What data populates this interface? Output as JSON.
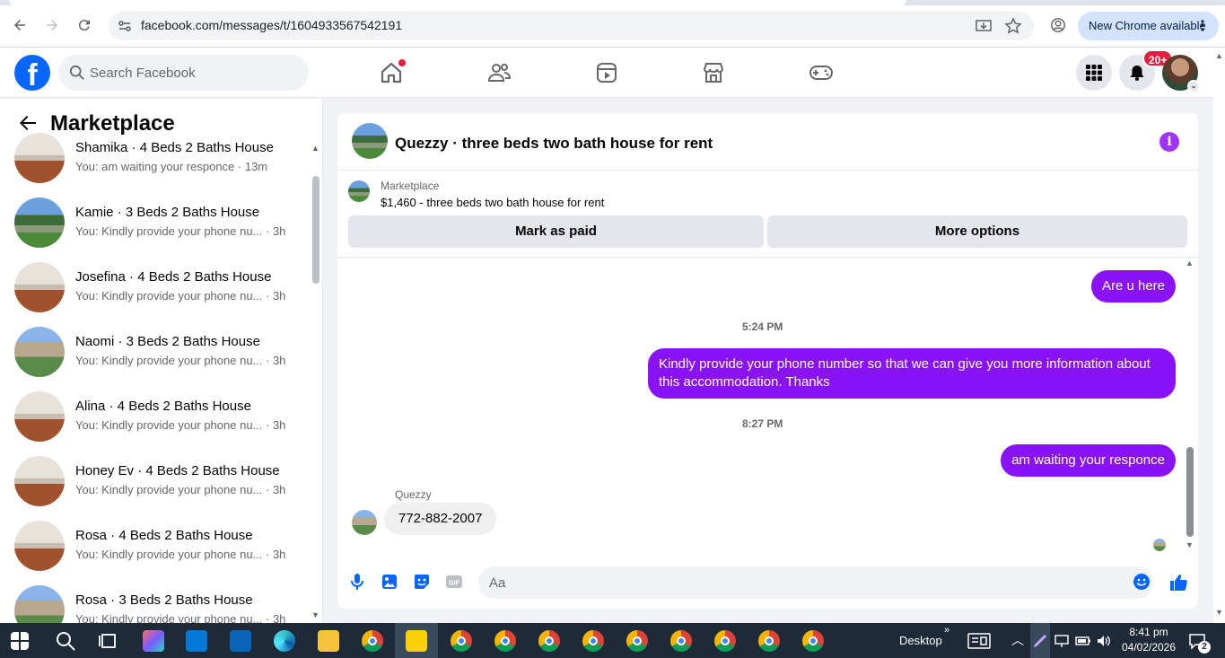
{
  "browser": {
    "url": "facebook.com/messages/t/1604933567542191",
    "new_chrome_label": "New Chrome available"
  },
  "header": {
    "search_placeholder": "Search Facebook",
    "notifications_badge": "20+"
  },
  "sidebar": {
    "title": "Marketplace",
    "conversations": [
      {
        "name": "Shamika · 4 Beds 2 Baths House",
        "preview": "You: am waiting your responce · 13m",
        "avatar": "room"
      },
      {
        "name": "Kamie · 3 Beds 2 Baths House",
        "preview": "You: Kindly provide your phone nu... · 3h",
        "avatar": "house"
      },
      {
        "name": "Josefina · 4 Beds 2 Baths House",
        "preview": "You: Kindly provide your phone nu... · 3h",
        "avatar": "room"
      },
      {
        "name": "Naomi · 3 Beds 2 Baths House",
        "preview": "You: Kindly provide your phone nu... · 3h",
        "avatar": "house2"
      },
      {
        "name": "Alina · 4 Beds 2 Baths House",
        "preview": "You: Kindly provide your phone nu... · 3h",
        "avatar": "room"
      },
      {
        "name": "Honey Ev · 4 Beds 2 Baths House",
        "preview": "You: Kindly provide your phone nu... · 3h",
        "avatar": "room"
      },
      {
        "name": "Rosa · 4 Beds 2 Baths House",
        "preview": "You: Kindly provide your phone nu... · 3h",
        "avatar": "room"
      },
      {
        "name": "Rosa · 3 Beds 2 Baths House",
        "preview": "You: Kindly provide your phone nu... · 3h",
        "avatar": "house2"
      }
    ]
  },
  "chat": {
    "title": "Quezzy · three beds two bath house for rent",
    "marketplace_label": "Marketplace",
    "listing": "$1,460 - three beds two bath house for rent",
    "mark_paid": "Mark as paid",
    "more_options": "More options",
    "messages": {
      "m1": "Are u here",
      "t1": "5:24 PM",
      "m2a": "Kindly provide your phone number so that we can give you more information about",
      "m2b": "this accommodation. Thanks",
      "t2": "8:27 PM",
      "m3": "am waiting your responce",
      "sender": "Quezzy",
      "m4": "772-882-2007"
    },
    "composer_placeholder": "Aa"
  },
  "taskbar": {
    "desktop_label": "Desktop",
    "time": "8:41 pm",
    "date": "04/02/2026",
    "notif_count": "2"
  },
  "colors": {
    "fb_blue": "#0866ff",
    "bubble_purple": "#8a12f6",
    "accent_purple": "#a033ff"
  }
}
